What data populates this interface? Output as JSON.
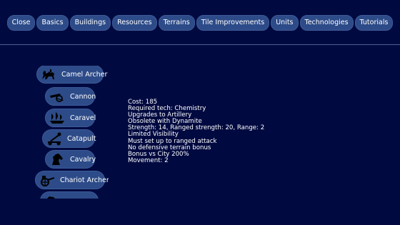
{
  "nav": {
    "tabs": [
      "Close",
      "Basics",
      "Buildings",
      "Resources",
      "Terrains",
      "Tile Improvements",
      "Units",
      "Technologies",
      "Tutorials"
    ]
  },
  "units": [
    {
      "label": "Camel Archer",
      "icon": "camel-archer-icon"
    },
    {
      "label": "Cannon",
      "icon": "cannon-icon"
    },
    {
      "label": "Caravel",
      "icon": "caravel-icon"
    },
    {
      "label": "Catapult",
      "icon": "catapult-icon"
    },
    {
      "label": "Cavalry",
      "icon": "cavalry-icon"
    },
    {
      "label": "Chariot Archer",
      "icon": "chariot-archer-icon"
    },
    {
      "label": "",
      "icon": "next-unit-icon"
    }
  ],
  "details": {
    "lines": [
      "Cost: 185",
      "Required tech: Chemistry",
      "Upgrades to Artillery",
      "Obsolete with Dynamite",
      "Strength: 14, Ranged strength: 20, Range: 2",
      "Limited Visibility",
      "Must set up to ranged attack",
      "No defensive terrain bonus",
      "Bonus vs City 200%",
      "Movement: 2"
    ]
  },
  "colors": {
    "background": "#010a40",
    "button": "#2d4b88",
    "text": "#ffffff"
  }
}
